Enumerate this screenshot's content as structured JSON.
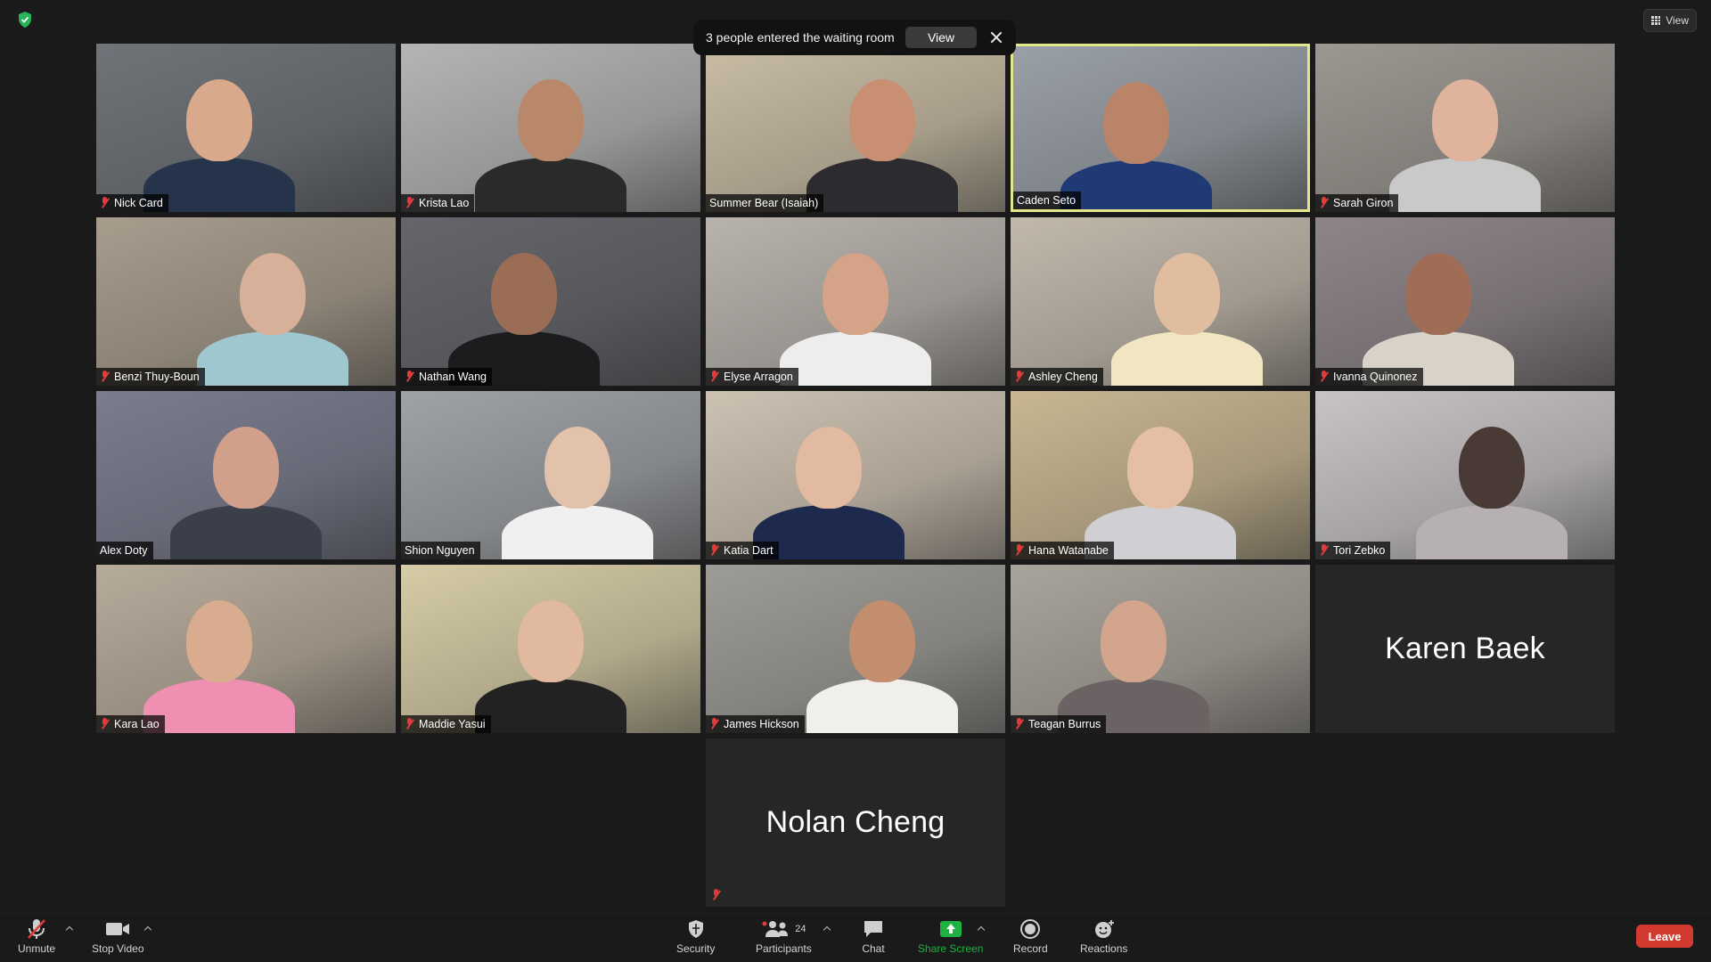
{
  "toast": {
    "message": "3 people entered the waiting room",
    "button_label": "View"
  },
  "view_label": "View",
  "tiles": [
    {
      "name": "Nick Card",
      "muted": true,
      "bg": "#6f7479",
      "skin": "#d9a98c",
      "shirt": "#25344a"
    },
    {
      "name": "Krista Lao",
      "muted": true,
      "bg": "#b4b5b4",
      "skin": "#b98769",
      "shirt": "#2a2a2a"
    },
    {
      "name": "Summer Bear (Isaiah)",
      "muted": false,
      "bg": "#c9bda5",
      "skin": "#c98f72",
      "shirt": "#2b2b30"
    },
    {
      "name": "Caden Seto",
      "muted": false,
      "bg": "#9aa0a7",
      "skin": "#b98468",
      "shirt": "#1f3a74"
    },
    {
      "name": "Sarah Giron",
      "muted": true,
      "bg": "#9c9791",
      "skin": "#e0b49c",
      "shirt": "#c9c9c9"
    },
    {
      "name": "Benzi Thuy-Boun",
      "muted": true,
      "bg": "#a89d8d",
      "skin": "#d7b09a",
      "shirt": "#9fc7cf"
    },
    {
      "name": "Nathan Wang",
      "muted": true,
      "bg": "#65666b",
      "skin": "#9b6d55",
      "shirt": "#1c1c1e"
    },
    {
      "name": "Elyse Arragon",
      "muted": true,
      "bg": "#b8b3ad",
      "skin": "#d5a387",
      "shirt": "#ededed"
    },
    {
      "name": "Ashley Cheng",
      "muted": true,
      "bg": "#c2b9ac",
      "skin": "#e1bda0",
      "shirt": "#f2e6c2"
    },
    {
      "name": "Ivanna Quinonez",
      "muted": true,
      "bg": "#8e8589",
      "skin": "#9f6d56",
      "shirt": "#d8d2c8"
    },
    {
      "name": "Alex Doty",
      "muted": false,
      "bg": "#7a7d8e",
      "skin": "#d1a08a",
      "shirt": "#3a3f4a"
    },
    {
      "name": "Shion Nguyen",
      "muted": false,
      "bg": "#9fa2a6",
      "skin": "#e2c2aa",
      "shirt": "#f0f0f0"
    },
    {
      "name": "Katia Dart",
      "muted": true,
      "bg": "#cdc2b2",
      "skin": "#e2b9a1",
      "shirt": "#1e2a4d"
    },
    {
      "name": "Hana Watanabe",
      "muted": true,
      "bg": "#c9b792",
      "skin": "#e4bfa5",
      "shirt": "#cfcfd4"
    },
    {
      "name": "Tori Zebko",
      "muted": true,
      "bg": "#c8c4c6",
      "skin": "#4a3a35",
      "shirt": "#b6b0b3"
    },
    {
      "name": "Kara Lao",
      "muted": true,
      "bg": "#b7ab9b",
      "skin": "#d9ac8f",
      "shirt": "#ef8fb2"
    },
    {
      "name": "Maddie Yasui",
      "muted": true,
      "bg": "#d6cca6",
      "skin": "#e1b99f",
      "shirt": "#222222"
    },
    {
      "name": "James Hickson",
      "muted": true,
      "bg": "#9e9c97",
      "skin": "#c38e6d",
      "shirt": "#f0efec"
    },
    {
      "name": "Teagan Burrus",
      "muted": true,
      "bg": "#a9a49c",
      "skin": "#d3a58d",
      "shirt": "#6b6263"
    },
    {
      "name": "Karen Baek",
      "muted": false,
      "plain": true
    }
  ],
  "plain_tile": {
    "name": "Nolan Cheng",
    "muted": true
  },
  "toolbar": {
    "unmute": "Unmute",
    "stop_video": "Stop Video",
    "security": "Security",
    "participants": "Participants",
    "participant_count": "24",
    "chat": "Chat",
    "share_screen": "Share Screen",
    "record": "Record",
    "reactions": "Reactions",
    "leave": "Leave"
  },
  "colors": {
    "active_speaker_border": "#e2e789",
    "share_screen_green": "#1fb141",
    "leave_red": "#d33a2f",
    "muted_red": "#e23b3b",
    "security_shield_green": "#28b35a"
  }
}
